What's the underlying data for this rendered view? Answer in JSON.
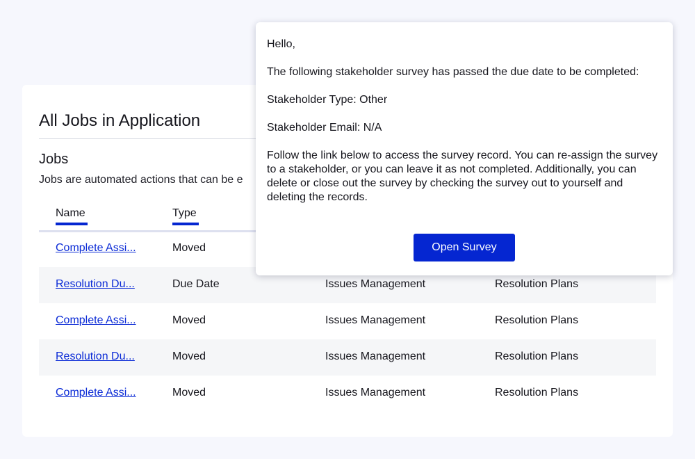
{
  "page": {
    "title": "All Jobs in Application",
    "section_title": "Jobs",
    "section_desc": "Jobs are automated actions that can be e"
  },
  "table": {
    "headers": [
      "Name",
      "Type"
    ],
    "rows": [
      {
        "name": "Complete Assi...",
        "type": "Moved",
        "application": "",
        "module": ""
      },
      {
        "name": "Resolution Du...",
        "type": "Due Date",
        "application": "Issues Management",
        "module": "Resolution Plans"
      },
      {
        "name": "Complete Assi...",
        "type": "Moved",
        "application": "Issues Management",
        "module": "Resolution Plans"
      },
      {
        "name": "Resolution Du...",
        "type": "Moved",
        "application": "Issues Management",
        "module": "Resolution Plans"
      },
      {
        "name": "Complete Assi...",
        "type": "Moved",
        "application": "Issues Management",
        "module": "Resolution Plans"
      }
    ]
  },
  "popup": {
    "greeting": "Hello,",
    "intro": "The following stakeholder survey has passed the due date to be completed:",
    "stakeholder_type": "Stakeholder Type: Other",
    "stakeholder_email": "Stakeholder Email: N/A",
    "instructions": "Follow the link below to access the survey record. You can re-assign the survey to a stakeholder, or you can leave it as not completed. Additionally, you can delete or close out the survey by checking the survey out to yourself and deleting the records.",
    "button_label": "Open Survey"
  },
  "colors": {
    "accent": "#0526d1",
    "link": "#0b2bd6",
    "background": "#f6f7fd",
    "row_alt": "#f5f6f8"
  }
}
